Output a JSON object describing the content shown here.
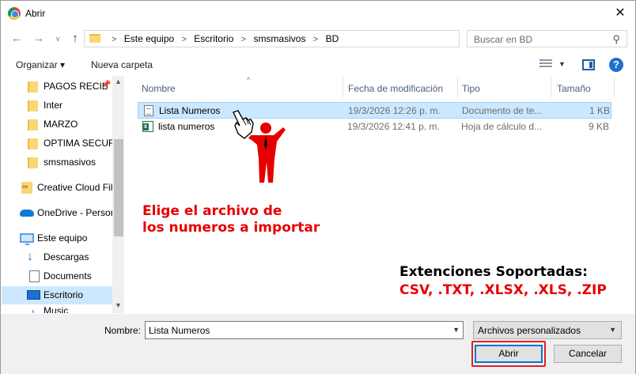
{
  "window": {
    "title": "Abrir"
  },
  "address": {
    "crumbs": [
      "Este equipo",
      "Escritorio",
      "smsmasivos",
      "BD"
    ],
    "sep": ">"
  },
  "search": {
    "placeholder": "Buscar en BD"
  },
  "toolbar": {
    "organize": "Organizar ▾",
    "new_folder": "Nueva carpeta"
  },
  "nav": {
    "items": [
      {
        "label": "PAGOS RECIB",
        "type": "folder"
      },
      {
        "label": "Inter",
        "type": "folder"
      },
      {
        "label": "MARZO",
        "type": "folder"
      },
      {
        "label": "OPTIMA SECURIT",
        "type": "folder"
      },
      {
        "label": "smsmasivos",
        "type": "folder"
      },
      {
        "label": "Creative Cloud Fil",
        "type": "creative-cloud"
      },
      {
        "label": "OneDrive - Persor",
        "type": "onedrive"
      },
      {
        "label": "Este equipo",
        "type": "pc"
      },
      {
        "label": "Descargas",
        "type": "downloads"
      },
      {
        "label": "Documents",
        "type": "documents"
      },
      {
        "label": "Escritorio",
        "type": "desktop",
        "selected": true
      },
      {
        "label": "Music",
        "type": "music"
      }
    ]
  },
  "columns": {
    "name": "Nombre",
    "modified": "Fecha de modificación",
    "type": "Tipo",
    "size": "Tamaño"
  },
  "files": [
    {
      "name": "Lista Numeros",
      "modified": "19/3/2026 12:26 p. m.",
      "type": "Documento de te...",
      "size": "1 KB",
      "icon": "text-file-icon",
      "selected": true
    },
    {
      "name": "lista numeros",
      "modified": "19/3/2026 12:41 p. m.",
      "type": "Hoja de cálculo d...",
      "size": "9 KB",
      "icon": "excel-file-icon",
      "selected": false
    }
  ],
  "annotations": {
    "instruction_line1": "Elige el archivo de",
    "instruction_line2": "los numeros a importar",
    "ext_title": "Extenciones Soportadas:",
    "ext_list": "CSV, .TXT, .XLSX, .XLS, .ZIP"
  },
  "bottom": {
    "name_label": "Nombre:",
    "name_value": "Lista Numeros",
    "filter_value": "Archivos personalizados",
    "open_label": "Abrir",
    "cancel_label": "Cancelar"
  },
  "colors": {
    "selection": "#cce8ff",
    "accent": "#0078d7",
    "annotation_red": "#e80000"
  }
}
